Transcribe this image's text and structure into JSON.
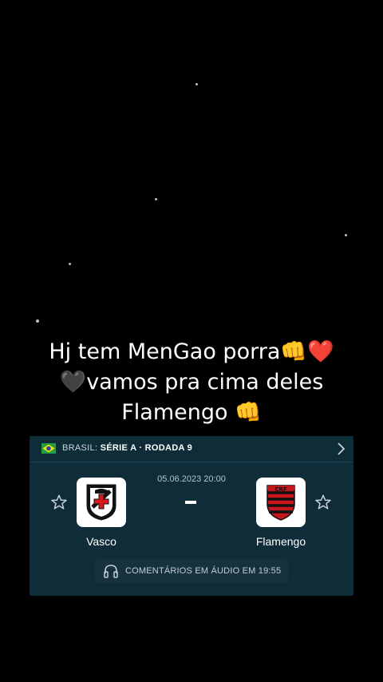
{
  "caption": {
    "line1": "Hj tem MenGao porra👊❤️",
    "line2": "🖤vamos pra cima deles",
    "line3": "Flamengo 👊"
  },
  "match_card": {
    "competition_country": "BRASIL:",
    "competition_name": "SÉRIE A · RODADA 9",
    "datetime": "05.06.2023 20:00",
    "home_team": {
      "name": "Vasco",
      "logo_icon": "vasco-crest-icon"
    },
    "away_team": {
      "name": "Flamengo",
      "logo_icon": "flamengo-crest-icon"
    },
    "audio_commentary": "COMENTÁRIOS EM ÁUDIO EM 19:55",
    "colors": {
      "card_bg": "#0f2d39",
      "pill_bg": "#17323f",
      "flamengo_red": "#c4161c"
    }
  }
}
